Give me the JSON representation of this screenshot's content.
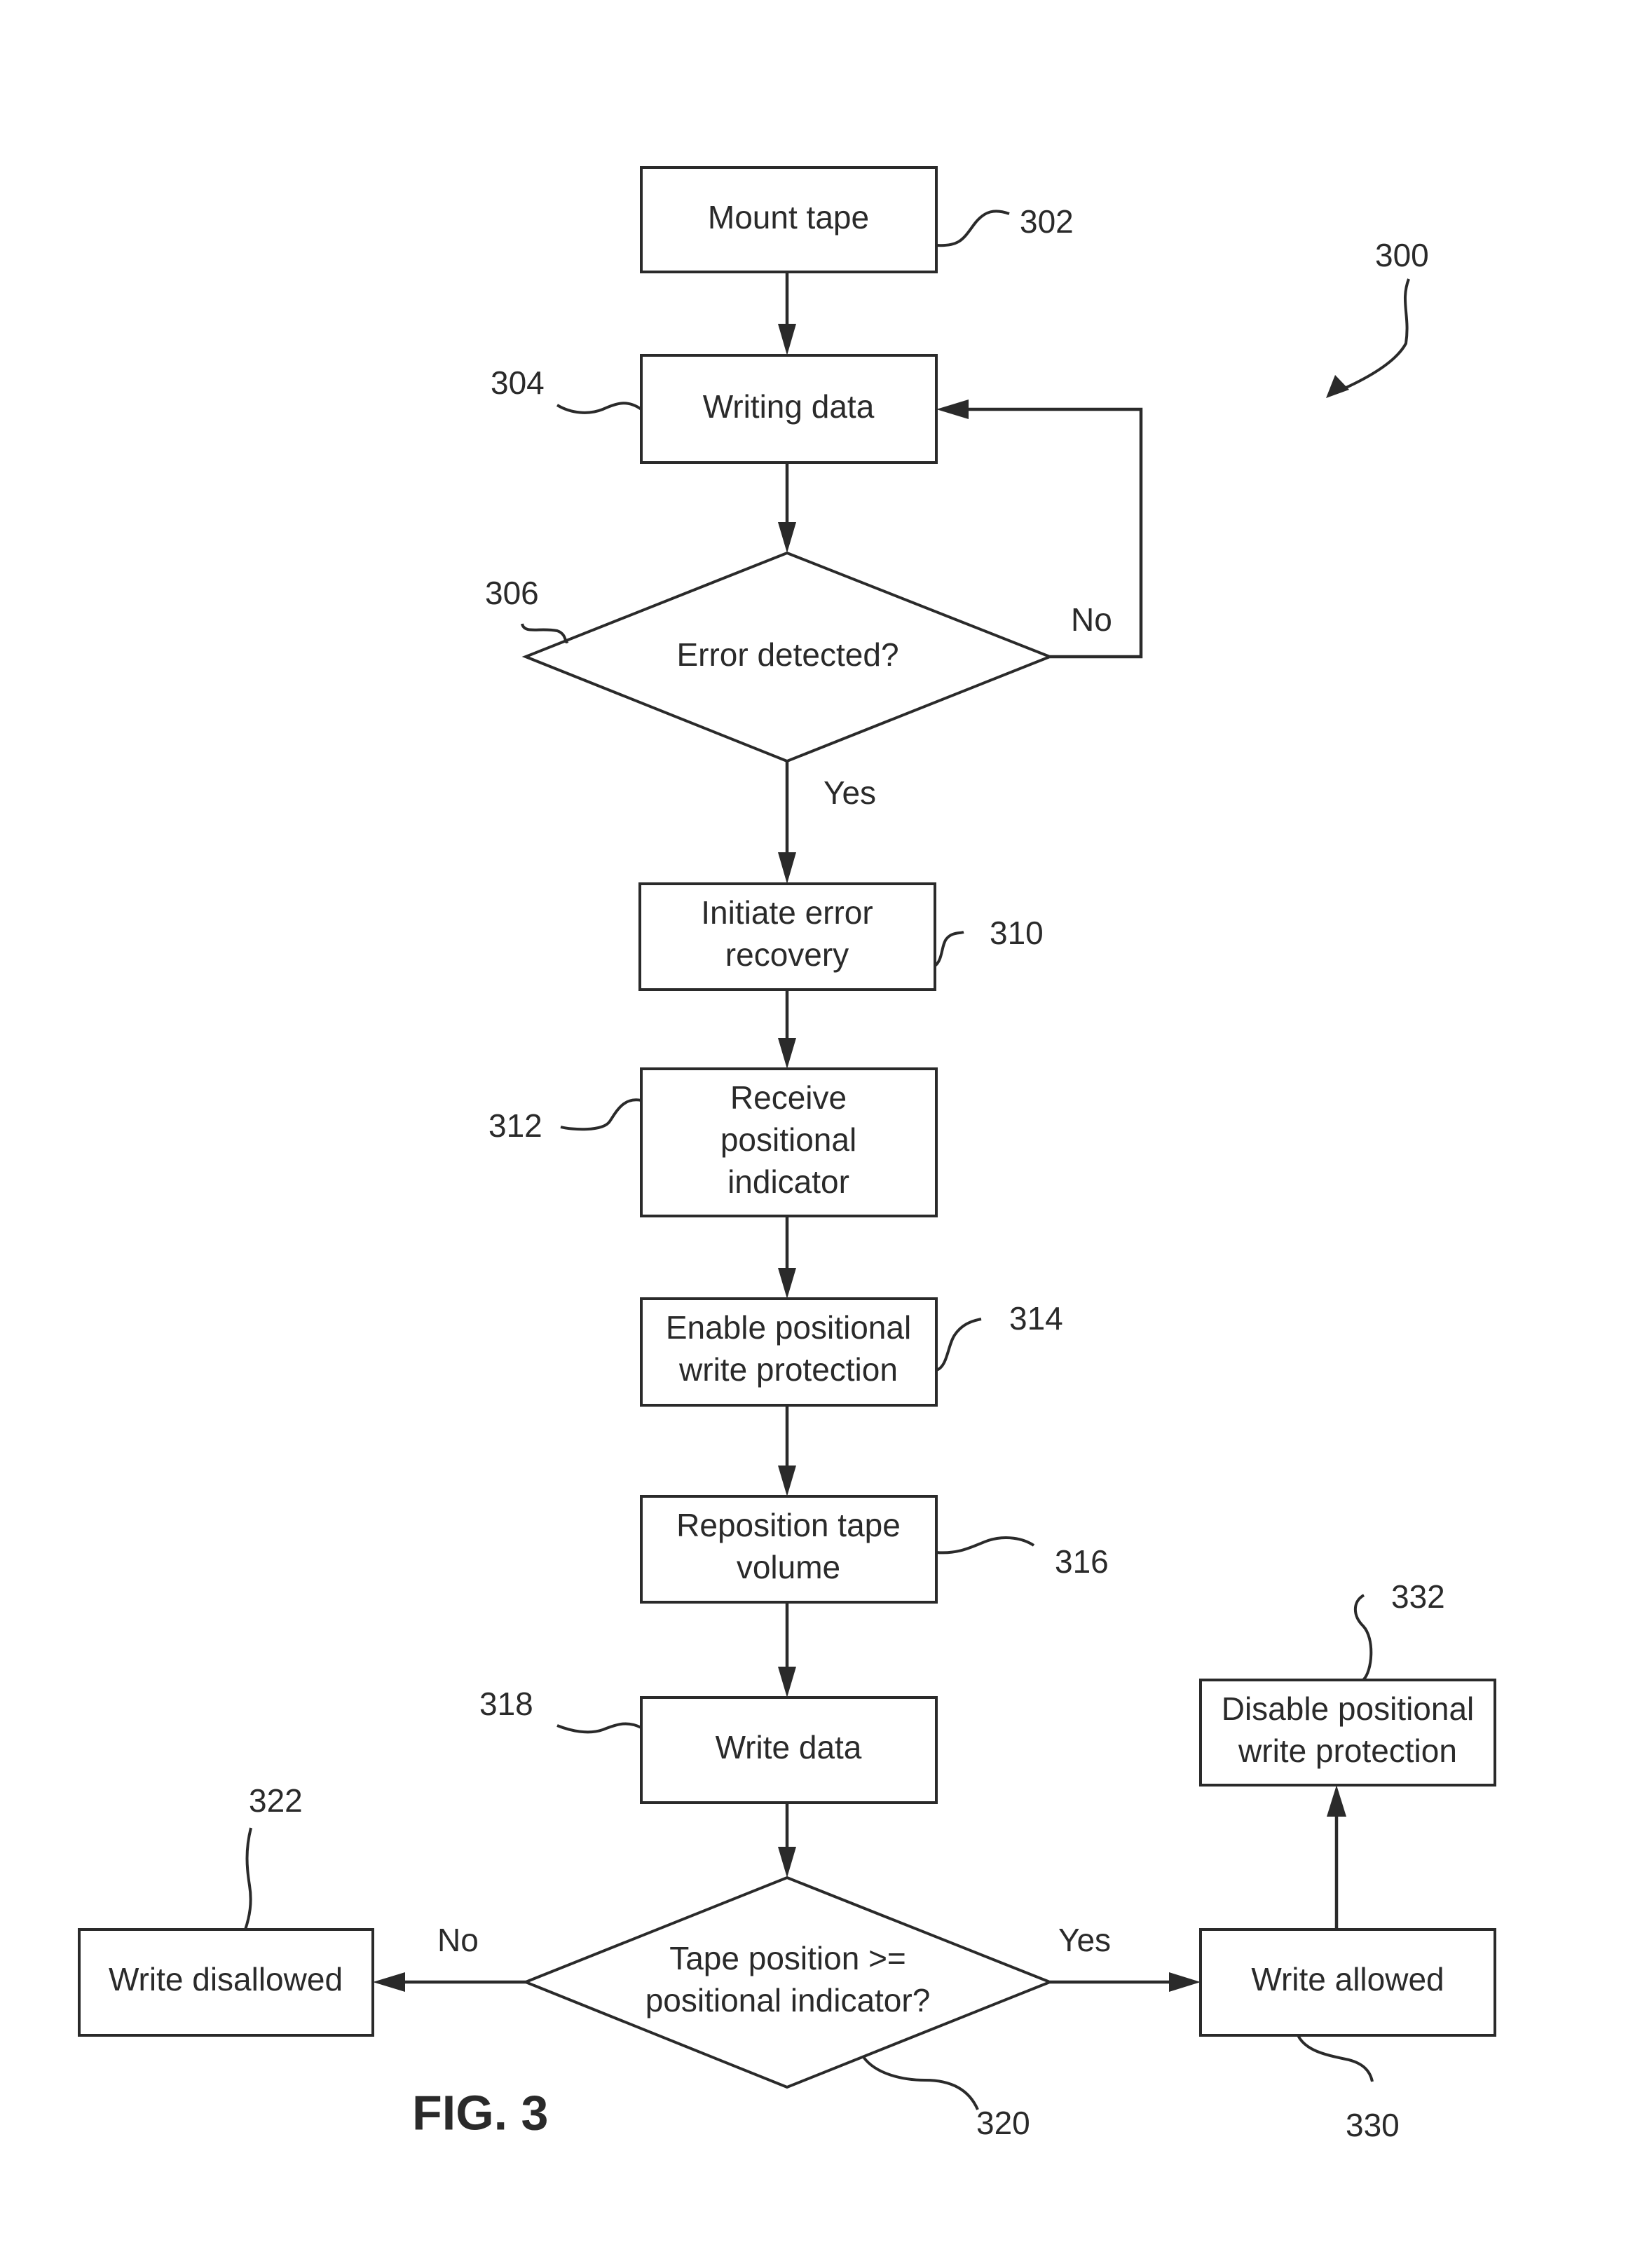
{
  "figure": {
    "id": "300",
    "caption": "FIG. 3"
  },
  "nodes": {
    "mount_tape": {
      "ref": "302",
      "lines": [
        "Mount tape"
      ]
    },
    "writing_data": {
      "ref": "304",
      "lines": [
        "Writing data"
      ]
    },
    "error_detected": {
      "ref": "306",
      "lines": [
        "Error detected?"
      ]
    },
    "initiate_recovery": {
      "ref": "310",
      "lines": [
        "Initiate error",
        "recovery"
      ]
    },
    "receive_indicator": {
      "ref": "312",
      "lines": [
        "Receive",
        "positional",
        "indicator"
      ]
    },
    "enable_protection": {
      "ref": "314",
      "lines": [
        "Enable positional",
        "write protection"
      ]
    },
    "reposition_tape": {
      "ref": "316",
      "lines": [
        "Reposition tape",
        "volume"
      ]
    },
    "write_data": {
      "ref": "318",
      "lines": [
        "Write data"
      ]
    },
    "tape_position_check": {
      "ref": "320",
      "lines": [
        "Tape position >=",
        "positional indicator?"
      ]
    },
    "write_disallowed": {
      "ref": "322",
      "lines": [
        "Write disallowed"
      ]
    },
    "write_allowed": {
      "ref": "330",
      "lines": [
        "Write allowed"
      ]
    },
    "disable_protection": {
      "ref": "332",
      "lines": [
        "Disable positional",
        "write protection"
      ]
    }
  },
  "edge_labels": {
    "error_no": "No",
    "error_yes": "Yes",
    "position_no": "No",
    "position_yes": "Yes"
  }
}
